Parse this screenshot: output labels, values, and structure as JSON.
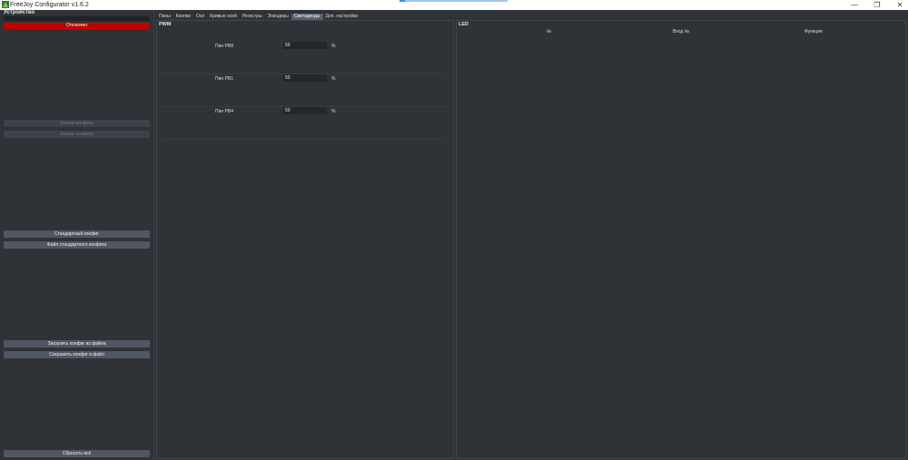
{
  "window": {
    "title": "FreeJoy Configurator v1.6.2",
    "minimize_glyph": "—",
    "maximize_glyph": "❐",
    "close_glyph": "✕",
    "icon": "freejoy-logo-icon"
  },
  "sidebar": {
    "header": "Устройство",
    "status": "Отключен",
    "read_config": "Чтение конфига",
    "write_config": "Запись конфига",
    "default_config": "Стандартный конфиг",
    "default_config_file": "Файл стандартного конфига",
    "load_from_file": "Загрузить конфиг из файла",
    "save_to_file": "Сохранить конфиг в файл",
    "reset_all": "Сбросить всё"
  },
  "tabs": [
    {
      "label": "Пины",
      "active": false
    },
    {
      "label": "Кнопки",
      "active": false
    },
    {
      "label": "Оси",
      "active": false
    },
    {
      "label": "Кривые осей",
      "active": false
    },
    {
      "label": "Регистры",
      "active": false
    },
    {
      "label": "Энкодеры",
      "active": false
    },
    {
      "label": "Светодиоды",
      "active": true
    },
    {
      "label": "Доп. настройки",
      "active": false
    }
  ],
  "pwm": {
    "title": "PWM",
    "rows": [
      {
        "label": "Пин PB8",
        "value": "50",
        "unit": "%"
      },
      {
        "label": "Пин PB1",
        "value": "50",
        "unit": "%"
      },
      {
        "label": "Пин PB4",
        "value": "50",
        "unit": "%"
      }
    ]
  },
  "led": {
    "title": "LED",
    "columns": [
      "№",
      "Вход №",
      "Функция"
    ]
  },
  "colors": {
    "background": "#2f3338",
    "status_red": "#c30000",
    "button": "#4f5862",
    "active_tab": "#55606b"
  }
}
